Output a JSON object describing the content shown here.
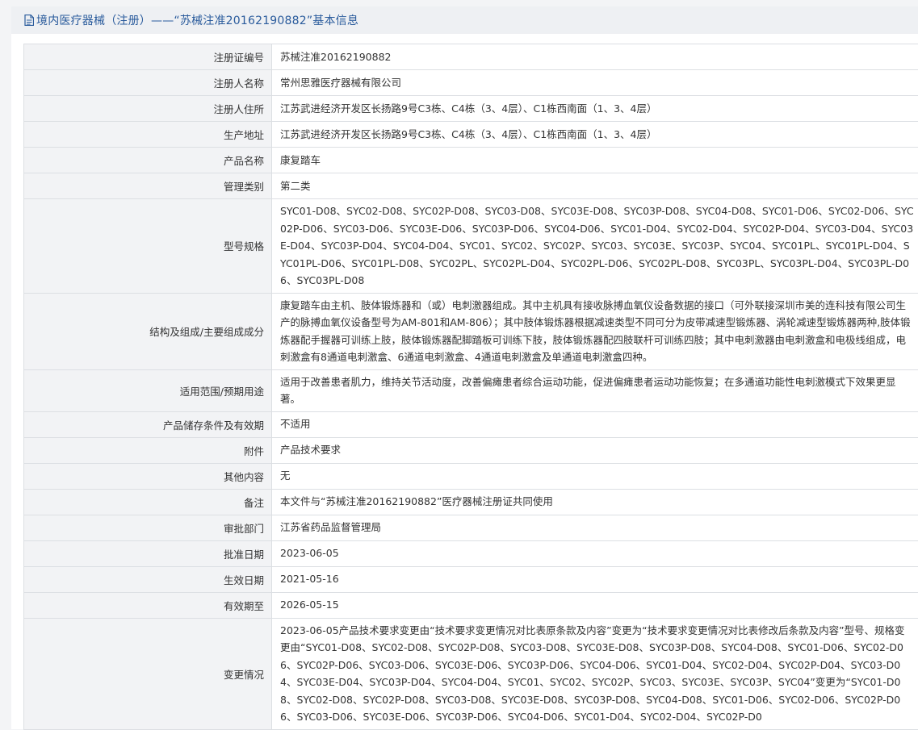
{
  "header": {
    "icon": "document-icon",
    "title": "境内医疗器械（注册）——“苏械注准20162190882”基本信息"
  },
  "rows": [
    {
      "label": "注册证编号",
      "value": "苏械注准20162190882"
    },
    {
      "label": "注册人名称",
      "value": "常州思雅医疗器械有限公司"
    },
    {
      "label": "注册人住所",
      "value": "江苏武进经济开发区长扬路9号C3栋、C4栋（3、4层）、C1栋西南面（1、3、4层）"
    },
    {
      "label": "生产地址",
      "value": "江苏武进经济开发区长扬路9号C3栋、C4栋（3、4层）、C1栋西南面（1、3、4层）"
    },
    {
      "label": "产品名称",
      "value": "康复踏车"
    },
    {
      "label": "管理类别",
      "value": "第二类"
    },
    {
      "label": "型号规格",
      "value": "SYC01-D08、SYC02-D08、SYC02P-D08、SYC03-D08、SYC03E-D08、SYC03P-D08、SYC04-D08、SYC01-D06、SYC02-D06、SYC02P-D06、SYC03-D06、SYC03E-D06、SYC03P-D06、SYC04-D06、SYC01-D04、SYC02-D04、SYC02P-D04、SYC03-D04、SYC03E-D04、SYC03P-D04、SYC04-D04、SYC01、SYC02、SYC02P、SYC03、SYC03E、SYC03P、SYC04、SYC01PL、SYC01PL-D04、SYC01PL-D06、SYC01PL-D08、SYC02PL、SYC02PL-D04、SYC02PL-D06、SYC02PL-D08、SYC03PL、SYC03PL-D04、SYC03PL-D06、SYC03PL-D08"
    },
    {
      "label": "结构及组成/主要组成成分",
      "value": "康复踏车由主机、肢体锻炼器和（或）电刺激器组成。其中主机具有接收脉搏血氧仪设备数据的接口（可外联接深圳市美的连科技有限公司生产的脉搏血氧仪设备型号为AM-801和AM-806）；其中肢体锻炼器根据减速类型不同可分为皮带减速型锻炼器、涡轮减速型锻炼器两种,肢体锻炼器配手握器可训练上肢，肢体锻炼器配脚踏板可训练下肢，肢体锻炼器配四肢联杆可训练四肢；其中电刺激器由电刺激盒和电极线组成，电刺激盒有8通道电刺激盒、6通道电刺激盒、4通道电刺激盒及单通道电刺激盒四种。"
    },
    {
      "label": "适用范围/预期用途",
      "value": "适用于改善患者肌力，维持关节活动度，改善偏瘫患者综合运动功能，促进偏瘫患者运动功能恢复；在多通道功能性电刺激模式下效果更显著。"
    },
    {
      "label": "产品储存条件及有效期",
      "value": "不适用"
    },
    {
      "label": "附件",
      "value": "产品技术要求"
    },
    {
      "label": "其他内容",
      "value": "无"
    },
    {
      "label": "备注",
      "value": "本文件与“苏械注准20162190882”医疗器械注册证共同使用"
    },
    {
      "label": "审批部门",
      "value": "江苏省药品监督管理局"
    },
    {
      "label": "批准日期",
      "value": "2023-06-05"
    },
    {
      "label": "生效日期",
      "value": "2021-05-16"
    },
    {
      "label": "有效期至",
      "value": "2026-05-15"
    },
    {
      "label": "变更情况",
      "value": "2023-06-05产品技术要求变更由“技术要求变更情况对比表原条款及内容”变更为“技术要求变更情况对比表修改后条款及内容”型号、规格变更由“SYC01-D08、SYC02-D08、SYC02P-D08、SYC03-D08、SYC03E-D08、SYC03P-D08、SYC04-D08、SYC01-D06、SYC02-D06、SYC02P-D06、SYC03-D06、SYC03E-D06、SYC03P-D06、SYC04-D06、SYC01-D04、SYC02-D04、SYC02P-D04、SYC03-D04、SYC03E-D04、SYC03P-D04、SYC04-D04、SYC01、SYC02、SYC02P、SYC03、SYC03E、SYC03P、SYC04”变更为“SYC01-D08、SYC02-D08、SYC02P-D08、SYC03-D08、SYC03E-D08、SYC03P-D08、SYC04-D08、SYC01-D06、SYC02-D06、SYC02P-D06、SYC03-D06、SYC03E-D06、SYC03P-D06、SYC04-D06、SYC01-D04、SYC02-D04、SYC02P-D0"
    }
  ]
}
